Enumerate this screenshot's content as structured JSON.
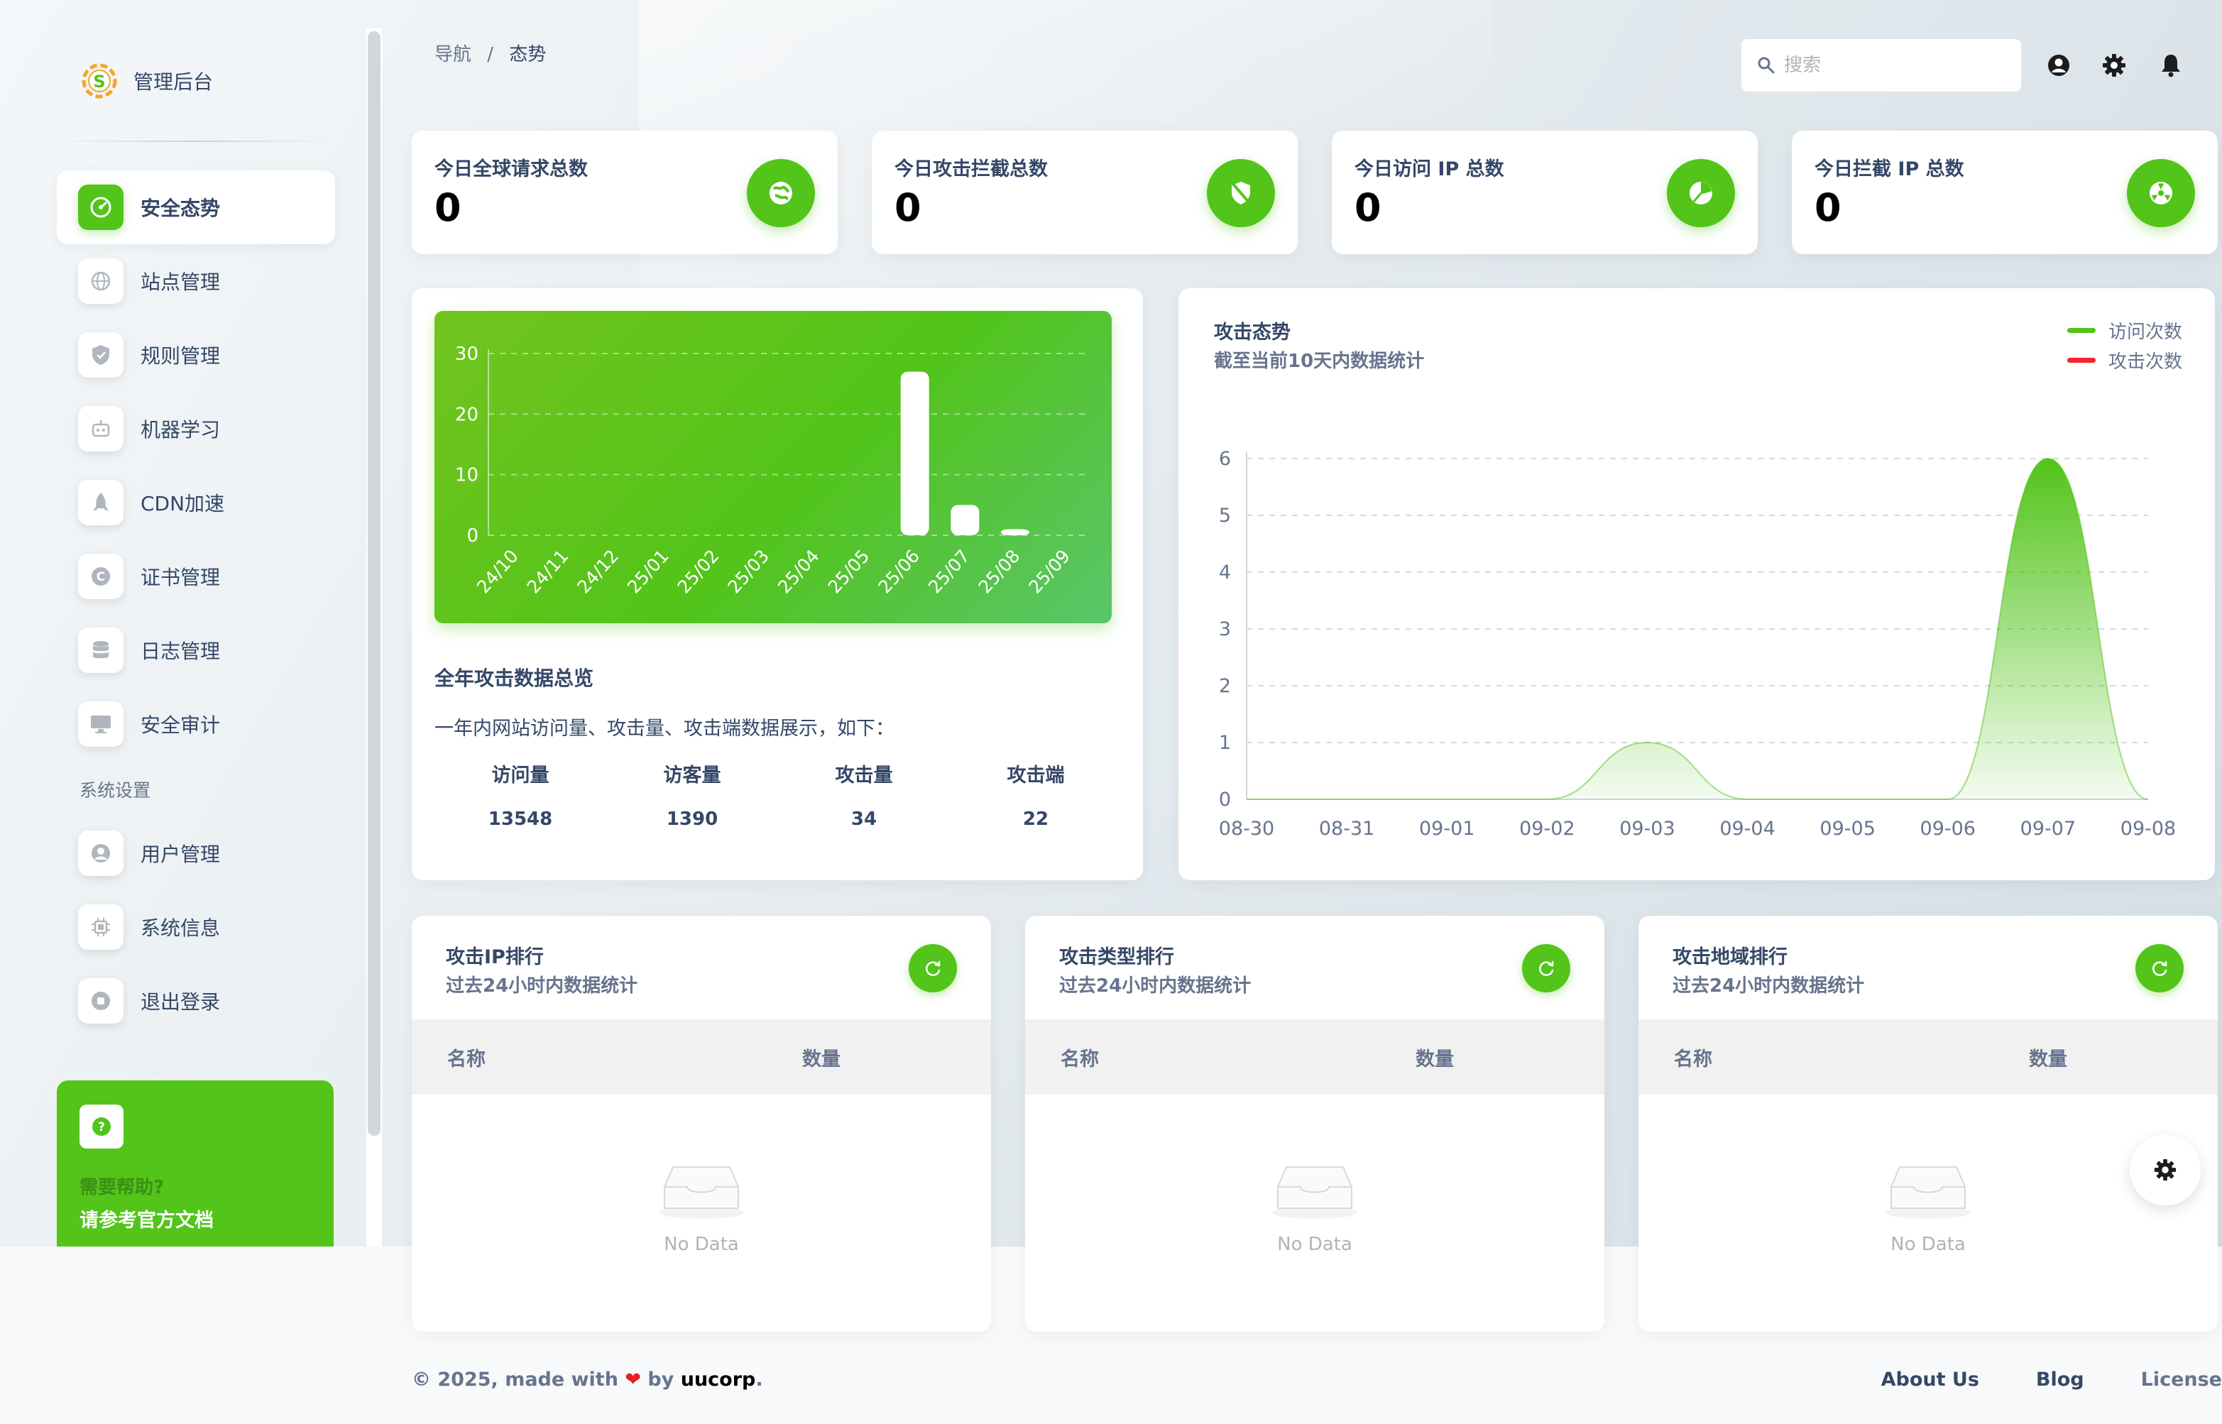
{
  "brand": {
    "title": "管理后台"
  },
  "sidebar": {
    "items": [
      {
        "label": "安全态势",
        "icon": "speedometer-icon",
        "active": true
      },
      {
        "label": "站点管理",
        "icon": "globe-icon"
      },
      {
        "label": "规则管理",
        "icon": "shield-icon"
      },
      {
        "label": "机器学习",
        "icon": "robot-icon"
      },
      {
        "label": "CDN加速",
        "icon": "rocket-icon"
      },
      {
        "label": "证书管理",
        "icon": "certificate-icon"
      },
      {
        "label": "日志管理",
        "icon": "database-icon"
      },
      {
        "label": "安全审计",
        "icon": "monitor-icon"
      }
    ],
    "section_label": "系统设置",
    "system_items": [
      {
        "label": "用户管理",
        "icon": "user-circle-icon"
      },
      {
        "label": "系统信息",
        "icon": "chip-icon"
      },
      {
        "label": "退出登录",
        "icon": "stop-circle-icon"
      }
    ],
    "help": {
      "title": "需要帮助?",
      "subtitle": "请参考官方文档"
    }
  },
  "header": {
    "breadcrumb": [
      "导航",
      "态势"
    ],
    "search_placeholder": "搜索"
  },
  "stats": [
    {
      "title": "今日全球请求总数",
      "value": "0",
      "icon": "globe-icon"
    },
    {
      "title": "今日攻击拦截总数",
      "value": "0",
      "icon": "shield-slash-icon"
    },
    {
      "title": "今日访问 IP 总数",
      "value": "0",
      "icon": "pie-chart-icon"
    },
    {
      "title": "今日拦截 IP 总数",
      "value": "0",
      "icon": "radiation-icon"
    }
  ],
  "yearly": {
    "title": "全年攻击数据总览",
    "description": "一年内网站访问量、攻击量、攻击端数据展示，如下：",
    "stats": [
      {
        "label": "访问量",
        "value": "13548"
      },
      {
        "label": "访客量",
        "value": "1390"
      },
      {
        "label": "攻击量",
        "value": "34"
      },
      {
        "label": "攻击端",
        "value": "22"
      }
    ]
  },
  "trend": {
    "title": "攻击态势",
    "subtitle": "截至当前10天内数据统计"
  },
  "rankings": [
    {
      "title": "攻击IP排行",
      "subtitle": "过去24小时内数据统计",
      "col_name": "名称",
      "col_count": "数量",
      "empty": "No Data"
    },
    {
      "title": "攻击类型排行",
      "subtitle": "过去24小时内数据统计",
      "col_name": "名称",
      "col_count": "数量",
      "empty": "No Data"
    },
    {
      "title": "攻击地域排行",
      "subtitle": "过去24小时内数据统计",
      "col_name": "名称",
      "col_count": "数量",
      "empty": "No Data"
    }
  ],
  "footer": {
    "prefix": "© 2025, made with",
    "heart": "❤",
    "by": "by",
    "brand": "uucorp",
    "suffix": ".",
    "links": [
      "About Us",
      "Blog",
      "License"
    ]
  },
  "colors": {
    "accent": "#52c41a",
    "attack": "#f5222d",
    "text": "#344767",
    "muted": "#67748e"
  },
  "chart_data": [
    {
      "type": "bar",
      "title": "",
      "categories": [
        "24/10",
        "24/11",
        "24/12",
        "25/01",
        "25/02",
        "25/03",
        "25/04",
        "25/05",
        "25/06",
        "25/07",
        "25/08",
        "25/09"
      ],
      "values": [
        0,
        0,
        0,
        0,
        0,
        0,
        0,
        0,
        27,
        5,
        1,
        0
      ],
      "ylim": [
        0,
        30
      ],
      "yticks": [
        0,
        10,
        20,
        30
      ],
      "grid": true
    },
    {
      "type": "area",
      "title": "攻击态势",
      "categories": [
        "08-30",
        "08-31",
        "09-01",
        "09-02",
        "09-03",
        "09-04",
        "09-05",
        "09-06",
        "09-07",
        "09-08"
      ],
      "series": [
        {
          "name": "访问次数",
          "color": "#52c41a",
          "values": [
            0,
            0,
            0,
            0,
            1,
            0,
            0,
            0,
            6,
            0
          ]
        },
        {
          "name": "攻击次数",
          "color": "#f5222d",
          "values": [
            0,
            0,
            0,
            0,
            0,
            0,
            0,
            0,
            0,
            0
          ]
        }
      ],
      "ylim": [
        0,
        6
      ],
      "yticks": [
        0,
        1,
        2,
        3,
        4,
        5,
        6
      ],
      "grid": true,
      "legend": "top-right"
    }
  ]
}
